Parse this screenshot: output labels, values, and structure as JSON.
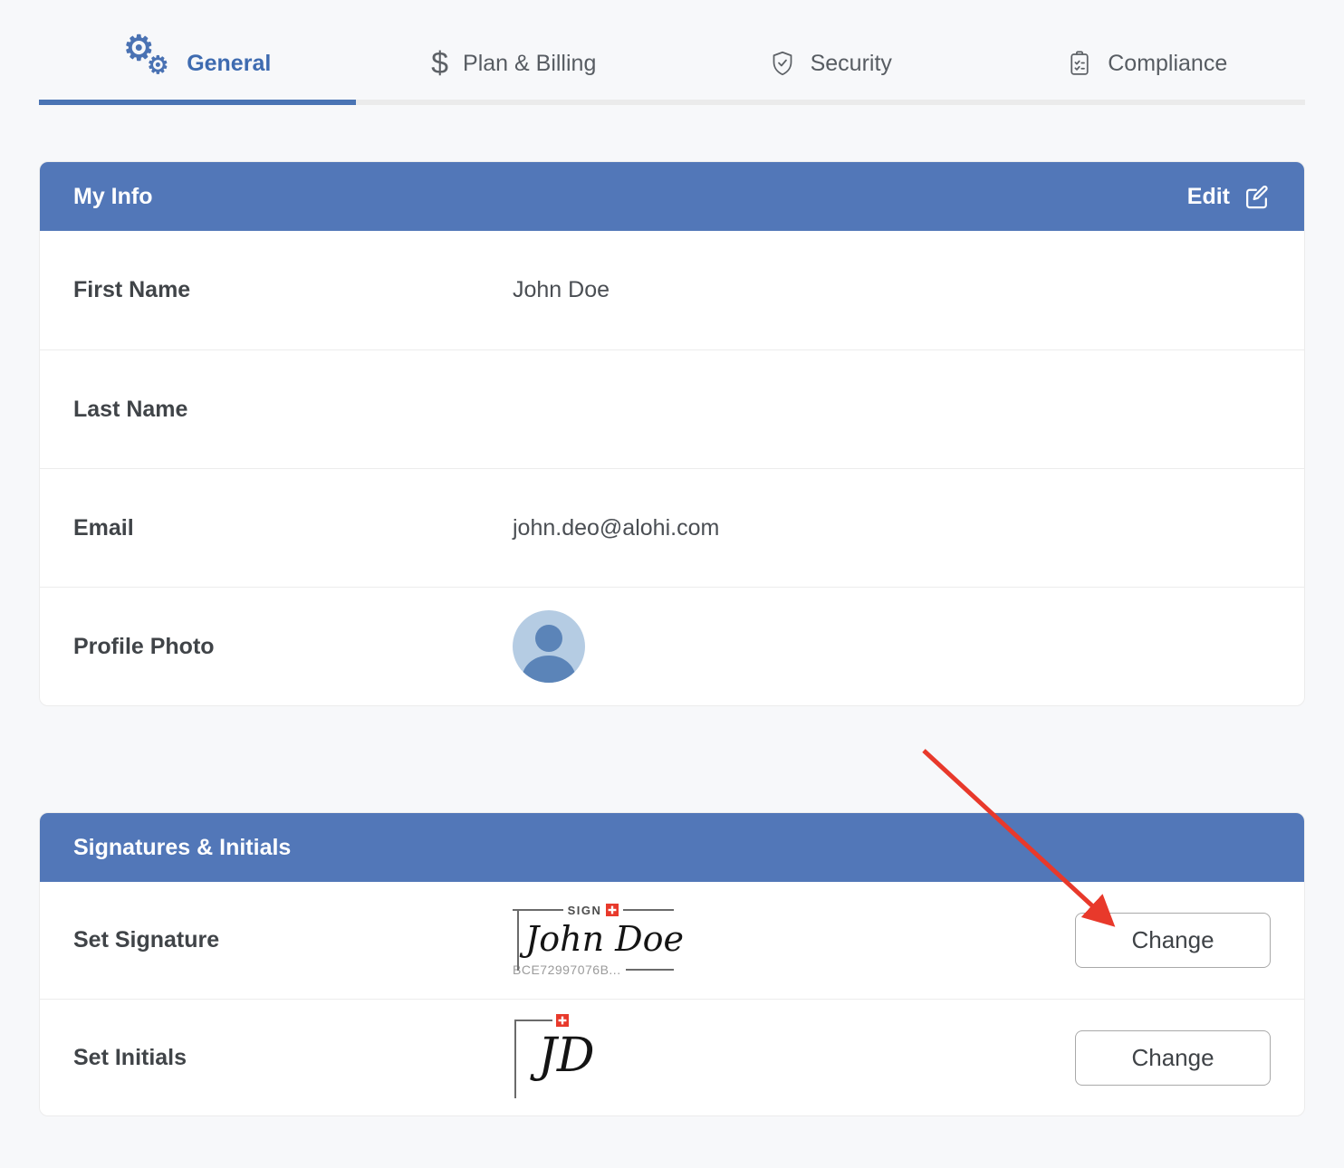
{
  "tabs": [
    {
      "label": "General",
      "icon": "gears-icon",
      "active": true
    },
    {
      "label": "Plan & Billing",
      "icon": "dollar-icon",
      "active": false
    },
    {
      "label": "Security",
      "icon": "shield-check-icon",
      "active": false
    },
    {
      "label": "Compliance",
      "icon": "clipboard-check-icon",
      "active": false
    }
  ],
  "my_info": {
    "title": "My Info",
    "edit_button": "Edit",
    "fields": [
      {
        "label": "First Name",
        "value": "John Doe"
      },
      {
        "label": "Last Name",
        "value": ""
      },
      {
        "label": "Email",
        "value": "john.deo@alohi.com"
      },
      {
        "label": "Profile Photo",
        "value": ""
      }
    ]
  },
  "signatures_section": {
    "title": "Signatures & Initials",
    "signature_row": {
      "label": "Set Signature",
      "brand": "SIGN",
      "script_text": "John Doe",
      "certificate_code": "BCE72997076B...",
      "button_label": "Change"
    },
    "initials_row": {
      "label": "Set Initials",
      "script_text": "JD",
      "button_label": "Change"
    }
  },
  "colors": {
    "header_blue": "#5277b8",
    "active_tab_blue": "#3e6bb0",
    "arrow_red": "#e8392b",
    "swiss_cross_red": "#e8392b",
    "avatar_bg": "#b5cce3",
    "avatar_person": "#5b84b8"
  }
}
